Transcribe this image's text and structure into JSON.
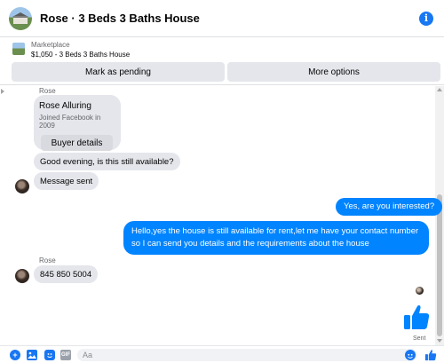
{
  "header": {
    "title": "Rose · 3 Beds 3 Baths House",
    "info_icon": "i"
  },
  "marketplace": {
    "label": "Marketplace",
    "listing": "$1,050 - 3 Beds 3 Baths House",
    "mark_pending": "Mark as pending",
    "more_options": "More options"
  },
  "conversation": {
    "sender_name_1": "Rose",
    "profile": {
      "name": "Rose Alluring",
      "joined": "Joined Facebook in 2009",
      "buyer_details": "Buyer details"
    },
    "incoming_1": "Good evening, is this still available?",
    "incoming_2": "Message sent",
    "outgoing_1": "Yes, are you interested?",
    "outgoing_2": "Hello,yes the house is still available for rent,let me have your contact number so I can send you details and the requirements about the house",
    "sender_name_2": "Rose",
    "incoming_3": "845 850 5004",
    "sent_status": "Sent"
  },
  "composer": {
    "placeholder": "Aa",
    "gif_label": "GIF",
    "plus_label": "+"
  },
  "colors": {
    "accent": "#0084ff",
    "brand": "#1877f2",
    "bubble_in": "#e4e6eb"
  },
  "icons": [
    "info-icon",
    "plus-icon",
    "photo-icon",
    "sticker-icon",
    "gif-icon",
    "emoji-icon",
    "thumbs-up-icon"
  ]
}
